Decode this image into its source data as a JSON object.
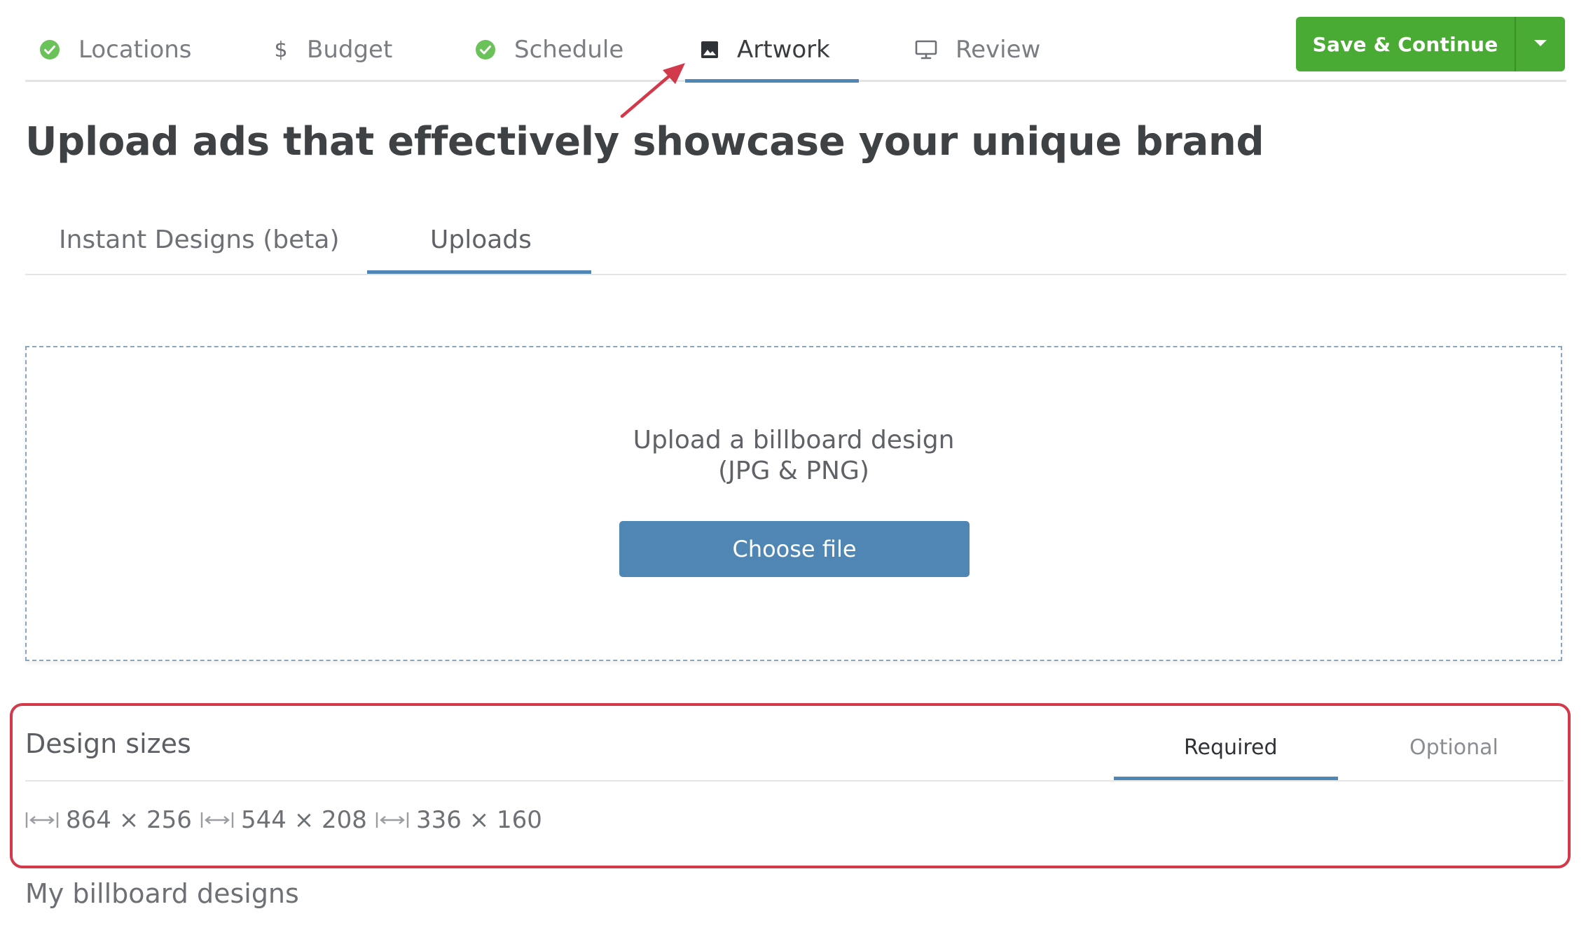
{
  "steps": [
    {
      "label": "Locations",
      "icon": "check-circle-icon",
      "status": "complete"
    },
    {
      "label": "Budget",
      "icon": "dollar-icon",
      "status": "incomplete"
    },
    {
      "label": "Schedule",
      "icon": "check-circle-icon",
      "status": "complete"
    },
    {
      "label": "Artwork",
      "icon": "image-icon",
      "status": "active"
    },
    {
      "label": "Review",
      "icon": "monitor-icon",
      "status": "incomplete"
    }
  ],
  "actions": {
    "save_label": "Save & Continue",
    "dropdown_icon": "caret-down-icon"
  },
  "page": {
    "title": "Upload ads that effectively showcase your unique brand"
  },
  "tabs": [
    {
      "label": "Instant Designs (beta)",
      "active": false
    },
    {
      "label": "Uploads",
      "active": true
    }
  ],
  "upload": {
    "prompt_line1": "Upload a billboard design",
    "prompt_line2": "(JPG & PNG)",
    "button_label": "Choose file"
  },
  "design_sizes": {
    "title": "Design sizes",
    "tabs": [
      {
        "label": "Required",
        "active": true
      },
      {
        "label": "Optional",
        "active": false
      }
    ],
    "items": [
      {
        "label": "864 × 256",
        "icon": "resize-width-icon"
      },
      {
        "label": "544 × 208",
        "icon": "resize-width-icon"
      },
      {
        "label": "336 × 160",
        "icon": "resize-width-icon"
      }
    ]
  },
  "my_designs": {
    "title": "My billboard designs"
  },
  "colors": {
    "success_green": "#4aab34",
    "accent_blue": "#4f86b5",
    "annotation_red": "#d23a4b",
    "check_green": "#6cc25a"
  }
}
